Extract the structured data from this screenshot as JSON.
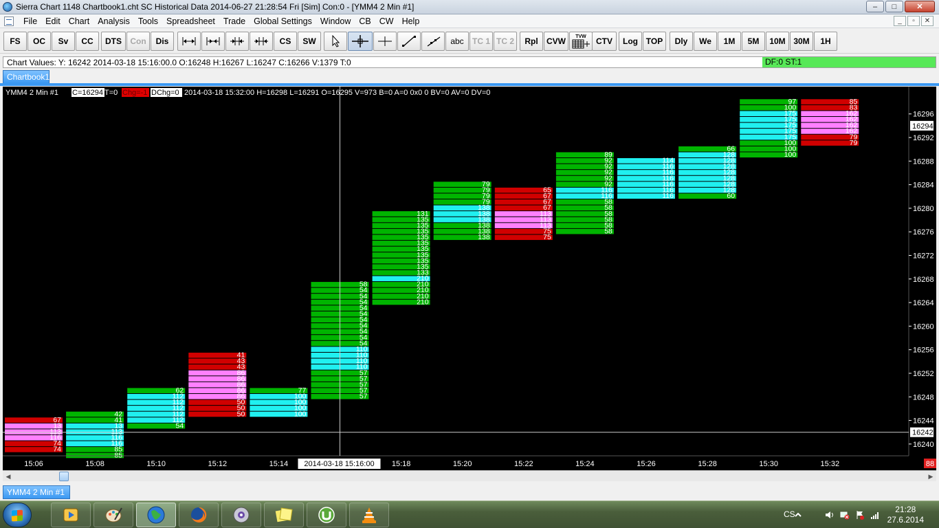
{
  "window": {
    "title": "Sierra Chart 1148 Chartbook1.cht  SC Historical Data 2014-06-27  21:28:54 Fri [Sim]  Con:0 - [YMM4  2 Min   #1]",
    "minimize": "–",
    "maximize": "□",
    "close": "✕"
  },
  "menu": {
    "items": [
      "File",
      "Edit",
      "Chart",
      "Analysis",
      "Tools",
      "Spreadsheet",
      "Trade",
      "Global Settings",
      "Window",
      "CB",
      "CW",
      "Help"
    ],
    "mdi": [
      "_",
      "▫",
      "✕"
    ]
  },
  "toolbar": {
    "fs": "FS",
    "oc": "OC",
    "sv": "Sv",
    "cc": "CC",
    "dts": "DTS",
    "con": "Con",
    "dis": "Dis",
    "cs": "CS",
    "sw": "SW",
    "abc": "abc",
    "tc1": "TC 1",
    "tc2": "TC 2",
    "rpl": "Rpl",
    "cvw": "CVW",
    "tvw": "TVW",
    "ctv": "CTV",
    "log": "Log",
    "top": "TOP",
    "dly": "Dly",
    "we": "We",
    "m1": "1M",
    "m5": "5M",
    "m10": "10M",
    "m30": "30M",
    "h1": "1H"
  },
  "values_bar": {
    "text": "Chart Values: Y: 16242  2014-03-18  15:16:00.0   O:16248  H:16267  L:16247  C:16266  V:1379  T:0",
    "status": "DF:0  ST:1"
  },
  "chartbook_tab": "Chartbook1",
  "chart_tab": "YMM4  2 Min   #1",
  "scroll": {
    "left": "◀",
    "right": "▶"
  },
  "header": {
    "symbol": "YMM4  2 Min   #1",
    "c": "C=16294",
    "t": "T=0",
    "chg": "Chg=-1",
    "dchg": "DChg=0",
    "rest": "2014-03-18 15:32:00 H=16298 L=16291 O=16295 V=973 B=0 A=0 0x0 0 BV=0 AV=0 DV=0"
  },
  "colors": {
    "green": "#00b400",
    "cyan": "#20f0f0",
    "pink": "#ff80ff",
    "red": "#d00000",
    "background": "#000000"
  },
  "chart_data": {
    "type": "bar",
    "ylim": [
      16238,
      16299
    ],
    "y_ticks": [
      16240,
      16244,
      16248,
      16252,
      16256,
      16260,
      16264,
      16268,
      16272,
      16276,
      16280,
      16284,
      16288,
      16292,
      16296
    ],
    "x_ticks": [
      "15:06",
      "15:08",
      "15:10",
      "15:12",
      "15:14",
      "15:18",
      "15:20",
      "15:22",
      "15:24",
      "15:26",
      "15:28",
      "15:30",
      "15:32"
    ],
    "crosshair": {
      "y_label": "16242",
      "x_label": "2014-03-18  15:16:00"
    },
    "last_price_label": "16294",
    "right_badge": "88",
    "bars": [
      {
        "time": "15:06",
        "levels": [
          {
            "p": 16244,
            "v": "67",
            "c": "red"
          },
          {
            "p": 16243,
            "v": "13",
            "c": "pink"
          },
          {
            "p": 16242,
            "v": "113",
            "c": "pink"
          },
          {
            "p": 16241,
            "v": "116",
            "c": "pink"
          },
          {
            "p": 16240,
            "v": "74",
            "c": "red"
          },
          {
            "p": 16239,
            "v": "74",
            "c": "red"
          }
        ]
      },
      {
        "time": "15:08",
        "levels": [
          {
            "p": 16245,
            "v": "42",
            "c": "green"
          },
          {
            "p": 16244,
            "v": "41",
            "c": "green"
          },
          {
            "p": 16243,
            "v": "13",
            "c": "cyan"
          },
          {
            "p": 16242,
            "v": "113",
            "c": "cyan"
          },
          {
            "p": 16241,
            "v": "116",
            "c": "cyan"
          },
          {
            "p": 16240,
            "v": "116",
            "c": "cyan"
          },
          {
            "p": 16239,
            "v": "85",
            "c": "green"
          },
          {
            "p": 16238,
            "v": "85",
            "c": "green"
          }
        ]
      },
      {
        "time": "15:10",
        "levels": [
          {
            "p": 16249,
            "v": "62",
            "c": "green"
          },
          {
            "p": 16248,
            "v": "112",
            "c": "cyan"
          },
          {
            "p": 16247,
            "v": "112",
            "c": "cyan"
          },
          {
            "p": 16246,
            "v": "112",
            "c": "cyan"
          },
          {
            "p": 16245,
            "v": "112",
            "c": "cyan"
          },
          {
            "p": 16244,
            "v": "112",
            "c": "cyan"
          },
          {
            "p": 16243,
            "v": "54",
            "c": "green"
          }
        ]
      },
      {
        "time": "15:12",
        "levels": [
          {
            "p": 16255,
            "v": "41",
            "c": "red"
          },
          {
            "p": 16254,
            "v": "43",
            "c": "red"
          },
          {
            "p": 16253,
            "v": "43",
            "c": "red"
          },
          {
            "p": 16252,
            "v": "86",
            "c": "pink"
          },
          {
            "p": 16251,
            "v": "86",
            "c": "pink"
          },
          {
            "p": 16250,
            "v": "86",
            "c": "pink"
          },
          {
            "p": 16249,
            "v": "86",
            "c": "pink"
          },
          {
            "p": 16248,
            "v": "86",
            "c": "pink"
          },
          {
            "p": 16247,
            "v": "50",
            "c": "red"
          },
          {
            "p": 16246,
            "v": "50",
            "c": "red"
          },
          {
            "p": 16245,
            "v": "50",
            "c": "red"
          }
        ]
      },
      {
        "time": "15:14",
        "levels": [
          {
            "p": 16249,
            "v": "77",
            "c": "green"
          },
          {
            "p": 16248,
            "v": "100",
            "c": "cyan"
          },
          {
            "p": 16247,
            "v": "100",
            "c": "cyan"
          },
          {
            "p": 16246,
            "v": "100",
            "c": "cyan"
          },
          {
            "p": 16245,
            "v": "100",
            "c": "cyan"
          }
        ]
      },
      {
        "time": "15:16",
        "levels": [
          {
            "p": 16267,
            "v": "58",
            "c": "green"
          },
          {
            "p": 16266,
            "v": "54",
            "c": "green"
          },
          {
            "p": 16265,
            "v": "54",
            "c": "green"
          },
          {
            "p": 16264,
            "v": "54",
            "c": "green"
          },
          {
            "p": 16263,
            "v": "54",
            "c": "green"
          },
          {
            "p": 16262,
            "v": "54",
            "c": "green"
          },
          {
            "p": 16261,
            "v": "54",
            "c": "green"
          },
          {
            "p": 16260,
            "v": "54",
            "c": "green"
          },
          {
            "p": 16259,
            "v": "54",
            "c": "green"
          },
          {
            "p": 16258,
            "v": "54",
            "c": "green"
          },
          {
            "p": 16257,
            "v": "54",
            "c": "green"
          },
          {
            "p": 16256,
            "v": "110",
            "c": "cyan"
          },
          {
            "p": 16255,
            "v": "110",
            "c": "cyan"
          },
          {
            "p": 16254,
            "v": "110",
            "c": "cyan"
          },
          {
            "p": 16253,
            "v": "110",
            "c": "cyan"
          },
          {
            "p": 16252,
            "v": "57",
            "c": "green"
          },
          {
            "p": 16251,
            "v": "57",
            "c": "green"
          },
          {
            "p": 16250,
            "v": "57",
            "c": "green"
          },
          {
            "p": 16249,
            "v": "57",
            "c": "green"
          },
          {
            "p": 16248,
            "v": "57",
            "c": "green"
          }
        ]
      },
      {
        "time": "15:18",
        "levels": [
          {
            "p": 16279,
            "v": "131",
            "c": "green"
          },
          {
            "p": 16278,
            "v": "135",
            "c": "green"
          },
          {
            "p": 16277,
            "v": "135",
            "c": "green"
          },
          {
            "p": 16276,
            "v": "135",
            "c": "green"
          },
          {
            "p": 16275,
            "v": "135",
            "c": "green"
          },
          {
            "p": 16274,
            "v": "135",
            "c": "green"
          },
          {
            "p": 16273,
            "v": "135",
            "c": "green"
          },
          {
            "p": 16272,
            "v": "135",
            "c": "green"
          },
          {
            "p": 16271,
            "v": "135",
            "c": "green"
          },
          {
            "p": 16270,
            "v": "135",
            "c": "green"
          },
          {
            "p": 16269,
            "v": "133",
            "c": "green"
          },
          {
            "p": 16268,
            "v": "210",
            "c": "cyan"
          },
          {
            "p": 16267,
            "v": "210",
            "c": "green"
          },
          {
            "p": 16266,
            "v": "210",
            "c": "green"
          },
          {
            "p": 16265,
            "v": "210",
            "c": "green"
          },
          {
            "p": 16264,
            "v": "210",
            "c": "green"
          }
        ]
      },
      {
        "time": "15:20",
        "levels": [
          {
            "p": 16284,
            "v": "79",
            "c": "green"
          },
          {
            "p": 16283,
            "v": "79",
            "c": "green"
          },
          {
            "p": 16282,
            "v": "79",
            "c": "green"
          },
          {
            "p": 16281,
            "v": "79",
            "c": "green"
          },
          {
            "p": 16280,
            "v": "138",
            "c": "cyan"
          },
          {
            "p": 16279,
            "v": "138",
            "c": "cyan"
          },
          {
            "p": 16278,
            "v": "138",
            "c": "cyan"
          },
          {
            "p": 16277,
            "v": "138",
            "c": "green"
          },
          {
            "p": 16276,
            "v": "138",
            "c": "green"
          },
          {
            "p": 16275,
            "v": "138",
            "c": "green"
          }
        ]
      },
      {
        "time": "15:22",
        "levels": [
          {
            "p": 16283,
            "v": "65",
            "c": "red"
          },
          {
            "p": 16282,
            "v": "67",
            "c": "red"
          },
          {
            "p": 16281,
            "v": "67",
            "c": "red"
          },
          {
            "p": 16280,
            "v": "67",
            "c": "red"
          },
          {
            "p": 16279,
            "v": "113",
            "c": "pink"
          },
          {
            "p": 16278,
            "v": "113",
            "c": "pink"
          },
          {
            "p": 16277,
            "v": "113",
            "c": "pink"
          },
          {
            "p": 16276,
            "v": "75",
            "c": "red"
          },
          {
            "p": 16275,
            "v": "75",
            "c": "red"
          }
        ]
      },
      {
        "time": "15:24",
        "levels": [
          {
            "p": 16289,
            "v": "89",
            "c": "green"
          },
          {
            "p": 16288,
            "v": "92",
            "c": "green"
          },
          {
            "p": 16287,
            "v": "92",
            "c": "green"
          },
          {
            "p": 16286,
            "v": "92",
            "c": "green"
          },
          {
            "p": 16285,
            "v": "92",
            "c": "green"
          },
          {
            "p": 16284,
            "v": "92",
            "c": "green"
          },
          {
            "p": 16283,
            "v": "116",
            "c": "cyan"
          },
          {
            "p": 16282,
            "v": "116",
            "c": "cyan"
          },
          {
            "p": 16281,
            "v": "58",
            "c": "green"
          },
          {
            "p": 16280,
            "v": "58",
            "c": "green"
          },
          {
            "p": 16279,
            "v": "58",
            "c": "green"
          },
          {
            "p": 16278,
            "v": "58",
            "c": "green"
          },
          {
            "p": 16277,
            "v": "58",
            "c": "green"
          },
          {
            "p": 16276,
            "v": "58",
            "c": "green"
          }
        ]
      },
      {
        "time": "15:26",
        "levels": [
          {
            "p": 16288,
            "v": "114",
            "c": "cyan"
          },
          {
            "p": 16287,
            "v": "116",
            "c": "cyan"
          },
          {
            "p": 16286,
            "v": "116",
            "c": "cyan"
          },
          {
            "p": 16285,
            "v": "116",
            "c": "cyan"
          },
          {
            "p": 16284,
            "v": "116",
            "c": "cyan"
          },
          {
            "p": 16283,
            "v": "116",
            "c": "cyan"
          },
          {
            "p": 16282,
            "v": "116",
            "c": "cyan"
          }
        ]
      },
      {
        "time": "15:28",
        "levels": [
          {
            "p": 16290,
            "v": "66",
            "c": "green"
          },
          {
            "p": 16289,
            "v": "128",
            "c": "cyan"
          },
          {
            "p": 16288,
            "v": "128",
            "c": "cyan"
          },
          {
            "p": 16287,
            "v": "128",
            "c": "cyan"
          },
          {
            "p": 16286,
            "v": "128",
            "c": "cyan"
          },
          {
            "p": 16285,
            "v": "128",
            "c": "cyan"
          },
          {
            "p": 16284,
            "v": "128",
            "c": "cyan"
          },
          {
            "p": 16283,
            "v": "128",
            "c": "cyan"
          },
          {
            "p": 16282,
            "v": "60",
            "c": "green"
          }
        ]
      },
      {
        "time": "15:30",
        "levels": [
          {
            "p": 16298,
            "v": "97",
            "c": "green"
          },
          {
            "p": 16297,
            "v": "100",
            "c": "green"
          },
          {
            "p": 16296,
            "v": "175",
            "c": "cyan"
          },
          {
            "p": 16295,
            "v": "175",
            "c": "cyan"
          },
          {
            "p": 16294,
            "v": "175",
            "c": "cyan"
          },
          {
            "p": 16293,
            "v": "175",
            "c": "cyan"
          },
          {
            "p": 16292,
            "v": "175",
            "c": "cyan"
          },
          {
            "p": 16291,
            "v": "100",
            "c": "green"
          },
          {
            "p": 16290,
            "v": "100",
            "c": "green"
          },
          {
            "p": 16289,
            "v": "100",
            "c": "green"
          }
        ]
      },
      {
        "time": "15:32",
        "levels": [
          {
            "p": 16298,
            "v": "85",
            "c": "red"
          },
          {
            "p": 16297,
            "v": "83",
            "c": "red"
          },
          {
            "p": 16296,
            "v": "162",
            "c": "pink"
          },
          {
            "p": 16295,
            "v": "162",
            "c": "pink"
          },
          {
            "p": 16294,
            "v": "162",
            "c": "pink"
          },
          {
            "p": 16293,
            "v": "162",
            "c": "pink"
          },
          {
            "p": 16292,
            "v": "79",
            "c": "red"
          },
          {
            "p": 16291,
            "v": "79",
            "c": "red"
          }
        ]
      }
    ]
  },
  "taskbar": {
    "apps": [
      "media-player",
      "paint",
      "sierra-chart",
      "firefox",
      "media-center",
      "notes",
      "utorrent",
      "vlc"
    ],
    "lang": "CS",
    "time": "21:28",
    "date": "27.6.2014"
  }
}
